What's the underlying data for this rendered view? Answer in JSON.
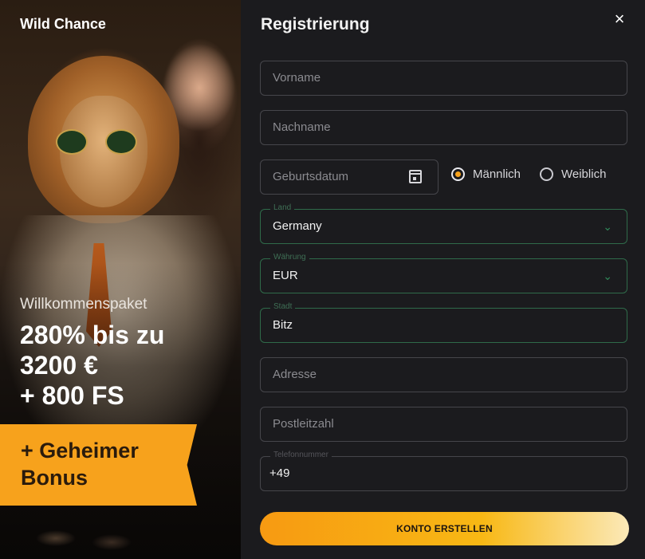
{
  "promo": {
    "brand": "Wild Chance",
    "package_label": "Willkommenspaket",
    "headline_lines": [
      "280% bis zu",
      "3200 €",
      "+ 800 FS"
    ],
    "ribbon_lines": [
      "+ Geheimer",
      "Bonus"
    ]
  },
  "form": {
    "title": "Registrierung",
    "close_glyph": "×",
    "fields": {
      "first_name": {
        "placeholder": "Vorname",
        "value": ""
      },
      "last_name": {
        "placeholder": "Nachname",
        "value": ""
      },
      "birthdate": {
        "placeholder": "Geburtsdatum",
        "value": "",
        "icon": "calendar-icon"
      },
      "country": {
        "label": "Land",
        "value": "Germany"
      },
      "currency": {
        "label": "Währung",
        "value": "EUR"
      },
      "city": {
        "label": "Stadt",
        "value": "Bitz"
      },
      "address": {
        "placeholder": "Adresse",
        "value": ""
      },
      "postal_code": {
        "placeholder": "Postleitzahl",
        "value": ""
      },
      "phone": {
        "label": "Telefonnummer",
        "value": "+49"
      }
    },
    "gender": {
      "male": {
        "label": "Männlich",
        "selected": true
      },
      "female": {
        "label": "Weiblich",
        "selected": false
      }
    },
    "submit_label": "KONTO ERSTELLEN",
    "dropdown_chevron": "⌄"
  },
  "colors": {
    "accent": "#f7a21c",
    "active_border": "#2f6b4a",
    "background": "#1b1b1e"
  }
}
